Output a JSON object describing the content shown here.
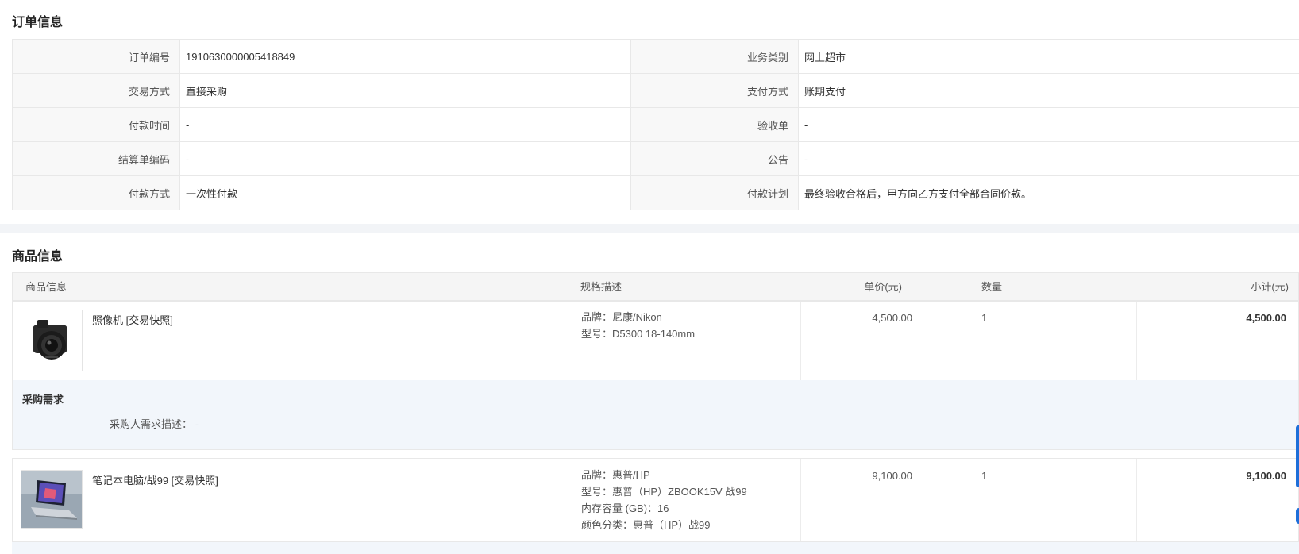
{
  "order_section": {
    "title": "订单信息",
    "rows": [
      {
        "l1": "订单编号",
        "v1": "1910630000005418849",
        "l2": "业务类别",
        "v2": "网上超市"
      },
      {
        "l1": "交易方式",
        "v1": "直接采购",
        "l2": "支付方式",
        "v2": "账期支付"
      },
      {
        "l1": "付款时间",
        "v1": "-",
        "l2": "验收单",
        "v2": "-"
      },
      {
        "l1": "结算单编码",
        "v1": "-",
        "l2": "公告",
        "v2": "-"
      },
      {
        "l1": "付款方式",
        "v1": "一次性付款",
        "l2": "付款计划",
        "v2": "最终验收合格后，甲方向乙方支付全部合同价款。"
      }
    ]
  },
  "product_section": {
    "title": "商品信息",
    "headers": {
      "info": "商品信息",
      "spec": "规格描述",
      "price": "单价(元)",
      "qty": "数量",
      "subtotal": "小计(元)"
    },
    "items": [
      {
        "name": "照像机 [交易快照]",
        "spec": [
          "品牌：尼康/Nikon",
          "型号：D5300 18-140mm"
        ],
        "price": "4,500.00",
        "qty": "1",
        "subtotal": "4,500.00",
        "thumb_icon": "camera-image"
      },
      {
        "name": "笔记本电脑/战99 [交易快照]",
        "spec": [
          "品牌：惠普/HP",
          "型号：惠普（HP）ZBOOK15V 战99",
          "内存容量 (GB)：16",
          "颜色分类：惠普（HP）战99"
        ],
        "price": "9,100.00",
        "qty": "1",
        "subtotal": "9,100.00",
        "thumb_icon": "laptop-image"
      }
    ],
    "requirement": {
      "title": "采购需求",
      "label": "采购人需求描述：",
      "value": "-"
    }
  },
  "colors": {
    "accent": "#1e6fd9",
    "label_bg": "#f8f8f8",
    "req_bg": "#f2f6fb"
  }
}
